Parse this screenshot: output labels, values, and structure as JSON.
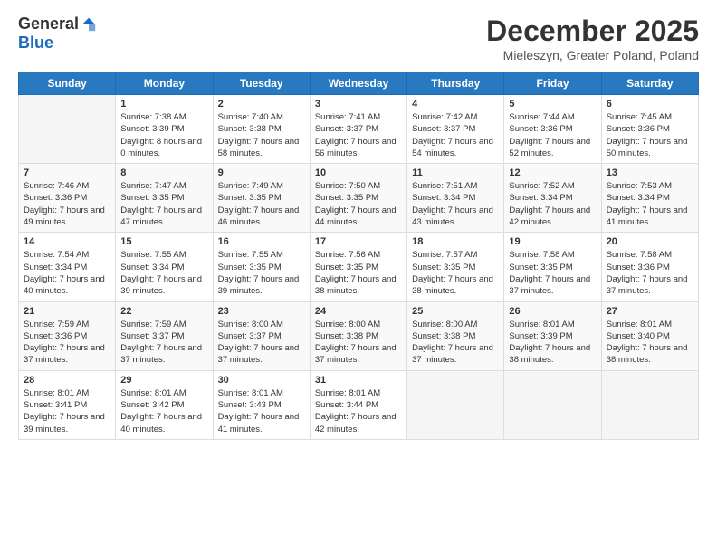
{
  "logo": {
    "general": "General",
    "blue": "Blue"
  },
  "header": {
    "title": "December 2025",
    "subtitle": "Mieleszyn, Greater Poland, Poland"
  },
  "days_of_week": [
    "Sunday",
    "Monday",
    "Tuesday",
    "Wednesday",
    "Thursday",
    "Friday",
    "Saturday"
  ],
  "weeks": [
    [
      {
        "day": "",
        "sunrise": "",
        "sunset": "",
        "daylight": ""
      },
      {
        "day": "1",
        "sunrise": "Sunrise: 7:38 AM",
        "sunset": "Sunset: 3:39 PM",
        "daylight": "Daylight: 8 hours and 0 minutes."
      },
      {
        "day": "2",
        "sunrise": "Sunrise: 7:40 AM",
        "sunset": "Sunset: 3:38 PM",
        "daylight": "Daylight: 7 hours and 58 minutes."
      },
      {
        "day": "3",
        "sunrise": "Sunrise: 7:41 AM",
        "sunset": "Sunset: 3:37 PM",
        "daylight": "Daylight: 7 hours and 56 minutes."
      },
      {
        "day": "4",
        "sunrise": "Sunrise: 7:42 AM",
        "sunset": "Sunset: 3:37 PM",
        "daylight": "Daylight: 7 hours and 54 minutes."
      },
      {
        "day": "5",
        "sunrise": "Sunrise: 7:44 AM",
        "sunset": "Sunset: 3:36 PM",
        "daylight": "Daylight: 7 hours and 52 minutes."
      },
      {
        "day": "6",
        "sunrise": "Sunrise: 7:45 AM",
        "sunset": "Sunset: 3:36 PM",
        "daylight": "Daylight: 7 hours and 50 minutes."
      }
    ],
    [
      {
        "day": "7",
        "sunrise": "Sunrise: 7:46 AM",
        "sunset": "Sunset: 3:36 PM",
        "daylight": "Daylight: 7 hours and 49 minutes."
      },
      {
        "day": "8",
        "sunrise": "Sunrise: 7:47 AM",
        "sunset": "Sunset: 3:35 PM",
        "daylight": "Daylight: 7 hours and 47 minutes."
      },
      {
        "day": "9",
        "sunrise": "Sunrise: 7:49 AM",
        "sunset": "Sunset: 3:35 PM",
        "daylight": "Daylight: 7 hours and 46 minutes."
      },
      {
        "day": "10",
        "sunrise": "Sunrise: 7:50 AM",
        "sunset": "Sunset: 3:35 PM",
        "daylight": "Daylight: 7 hours and 44 minutes."
      },
      {
        "day": "11",
        "sunrise": "Sunrise: 7:51 AM",
        "sunset": "Sunset: 3:34 PM",
        "daylight": "Daylight: 7 hours and 43 minutes."
      },
      {
        "day": "12",
        "sunrise": "Sunrise: 7:52 AM",
        "sunset": "Sunset: 3:34 PM",
        "daylight": "Daylight: 7 hours and 42 minutes."
      },
      {
        "day": "13",
        "sunrise": "Sunrise: 7:53 AM",
        "sunset": "Sunset: 3:34 PM",
        "daylight": "Daylight: 7 hours and 41 minutes."
      }
    ],
    [
      {
        "day": "14",
        "sunrise": "Sunrise: 7:54 AM",
        "sunset": "Sunset: 3:34 PM",
        "daylight": "Daylight: 7 hours and 40 minutes."
      },
      {
        "day": "15",
        "sunrise": "Sunrise: 7:55 AM",
        "sunset": "Sunset: 3:34 PM",
        "daylight": "Daylight: 7 hours and 39 minutes."
      },
      {
        "day": "16",
        "sunrise": "Sunrise: 7:55 AM",
        "sunset": "Sunset: 3:35 PM",
        "daylight": "Daylight: 7 hours and 39 minutes."
      },
      {
        "day": "17",
        "sunrise": "Sunrise: 7:56 AM",
        "sunset": "Sunset: 3:35 PM",
        "daylight": "Daylight: 7 hours and 38 minutes."
      },
      {
        "day": "18",
        "sunrise": "Sunrise: 7:57 AM",
        "sunset": "Sunset: 3:35 PM",
        "daylight": "Daylight: 7 hours and 38 minutes."
      },
      {
        "day": "19",
        "sunrise": "Sunrise: 7:58 AM",
        "sunset": "Sunset: 3:35 PM",
        "daylight": "Daylight: 7 hours and 37 minutes."
      },
      {
        "day": "20",
        "sunrise": "Sunrise: 7:58 AM",
        "sunset": "Sunset: 3:36 PM",
        "daylight": "Daylight: 7 hours and 37 minutes."
      }
    ],
    [
      {
        "day": "21",
        "sunrise": "Sunrise: 7:59 AM",
        "sunset": "Sunset: 3:36 PM",
        "daylight": "Daylight: 7 hours and 37 minutes."
      },
      {
        "day": "22",
        "sunrise": "Sunrise: 7:59 AM",
        "sunset": "Sunset: 3:37 PM",
        "daylight": "Daylight: 7 hours and 37 minutes."
      },
      {
        "day": "23",
        "sunrise": "Sunrise: 8:00 AM",
        "sunset": "Sunset: 3:37 PM",
        "daylight": "Daylight: 7 hours and 37 minutes."
      },
      {
        "day": "24",
        "sunrise": "Sunrise: 8:00 AM",
        "sunset": "Sunset: 3:38 PM",
        "daylight": "Daylight: 7 hours and 37 minutes."
      },
      {
        "day": "25",
        "sunrise": "Sunrise: 8:00 AM",
        "sunset": "Sunset: 3:38 PM",
        "daylight": "Daylight: 7 hours and 37 minutes."
      },
      {
        "day": "26",
        "sunrise": "Sunrise: 8:01 AM",
        "sunset": "Sunset: 3:39 PM",
        "daylight": "Daylight: 7 hours and 38 minutes."
      },
      {
        "day": "27",
        "sunrise": "Sunrise: 8:01 AM",
        "sunset": "Sunset: 3:40 PM",
        "daylight": "Daylight: 7 hours and 38 minutes."
      }
    ],
    [
      {
        "day": "28",
        "sunrise": "Sunrise: 8:01 AM",
        "sunset": "Sunset: 3:41 PM",
        "daylight": "Daylight: 7 hours and 39 minutes."
      },
      {
        "day": "29",
        "sunrise": "Sunrise: 8:01 AM",
        "sunset": "Sunset: 3:42 PM",
        "daylight": "Daylight: 7 hours and 40 minutes."
      },
      {
        "day": "30",
        "sunrise": "Sunrise: 8:01 AM",
        "sunset": "Sunset: 3:43 PM",
        "daylight": "Daylight: 7 hours and 41 minutes."
      },
      {
        "day": "31",
        "sunrise": "Sunrise: 8:01 AM",
        "sunset": "Sunset: 3:44 PM",
        "daylight": "Daylight: 7 hours and 42 minutes."
      },
      {
        "day": "",
        "sunrise": "",
        "sunset": "",
        "daylight": ""
      },
      {
        "day": "",
        "sunrise": "",
        "sunset": "",
        "daylight": ""
      },
      {
        "day": "",
        "sunrise": "",
        "sunset": "",
        "daylight": ""
      }
    ]
  ]
}
